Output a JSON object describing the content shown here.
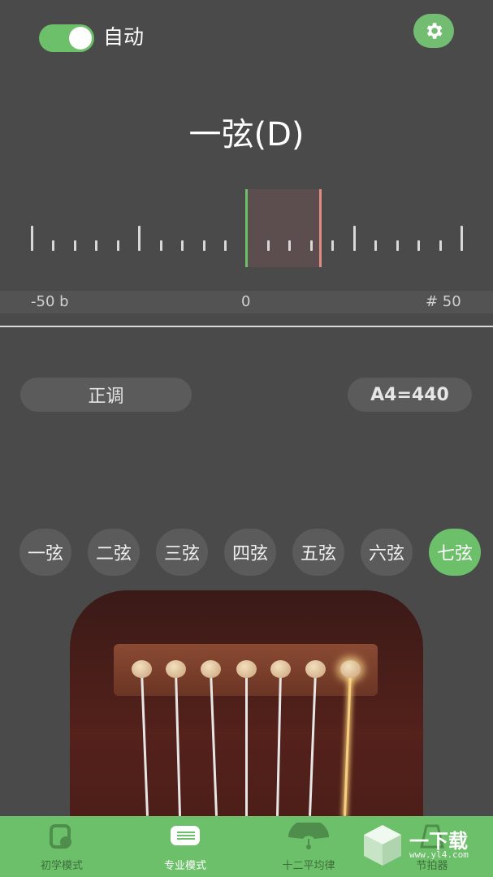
{
  "top": {
    "auto_label": "自动",
    "auto_enabled": true
  },
  "tuner": {
    "string_title": "一弦(D)",
    "scale_min": "-50 b",
    "scale_zero": "0",
    "scale_max": "# 50"
  },
  "controls": {
    "tuning_mode": "正调",
    "reference_pitch": "A4=440"
  },
  "strings": {
    "items": [
      "一弦",
      "二弦",
      "三弦",
      "四弦",
      "五弦",
      "六弦",
      "七弦"
    ],
    "active_index": 6
  },
  "nav": {
    "items": [
      {
        "label": "初学模式",
        "icon": "beginner-icon"
      },
      {
        "label": "专业模式",
        "icon": "pro-icon"
      },
      {
        "label": "十二平均律",
        "icon": "temperament-icon"
      },
      {
        "label": "节拍器",
        "icon": "metronome-icon"
      }
    ],
    "active_index": 1
  },
  "watermark": {
    "brand": "一下载",
    "url": "www.yl4.com"
  },
  "colors": {
    "accent": "#6cc069",
    "background": "#4a4a4a",
    "in_tune_marker": "#6cc069",
    "pitch_marker": "#e08b84"
  }
}
